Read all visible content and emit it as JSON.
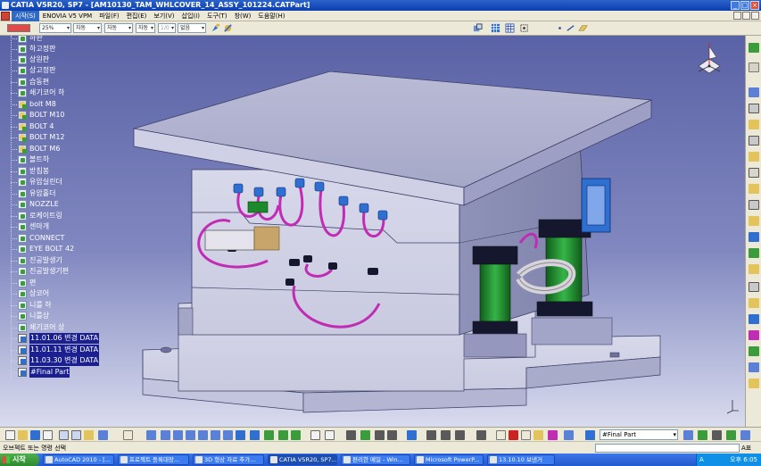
{
  "window": {
    "title": "CATIA V5R20, SP7 - [AM10130_TAM_WHLCOVER_14_ASSY_101224.CATPart]",
    "buttons": [
      "_",
      "□",
      "×"
    ]
  },
  "menubar": {
    "items": [
      "시작(S)",
      "ENOVIA V5 VPM",
      "파일(F)",
      "편집(E)",
      "보기(V)",
      "삽입(I)",
      "도구(T)",
      "창(W)",
      "도움말(H)"
    ]
  },
  "graphic_properties": {
    "transparency": "25%",
    "line_weight": "자동",
    "line_type": "자동",
    "point_symbol": "자동",
    "layer_value": "1/0",
    "layer": "없음",
    "fill_color": "#e24a4a"
  },
  "tree": {
    "items": [
      {
        "label": "하판",
        "icon": "part-icon"
      },
      {
        "label": "하고정판",
        "icon": "part-icon"
      },
      {
        "label": "상원판",
        "icon": "part-icon"
      },
      {
        "label": "상고정판",
        "icon": "part-icon"
      },
      {
        "label": "습동편",
        "icon": "part-icon"
      },
      {
        "label": "쇄기코어 하",
        "icon": "part-icon"
      },
      {
        "label": "bolt M8",
        "icon": "body-icon"
      },
      {
        "label": "BOLT M10",
        "icon": "body-icon"
      },
      {
        "label": "BOLT 4",
        "icon": "body-icon"
      },
      {
        "label": "BOLT M12",
        "icon": "body-icon"
      },
      {
        "label": "BOLT M6",
        "icon": "body-icon"
      },
      {
        "label": "볼트하",
        "icon": "part-icon"
      },
      {
        "label": "받침봉",
        "icon": "part-icon"
      },
      {
        "label": "유압실린더",
        "icon": "part-icon"
      },
      {
        "label": "유압홀더",
        "icon": "part-icon"
      },
      {
        "label": "NOZZLE",
        "icon": "part-icon"
      },
      {
        "label": "로케이트링",
        "icon": "part-icon"
      },
      {
        "label": "센마개",
        "icon": "part-icon"
      },
      {
        "label": "CONNECT",
        "icon": "part-icon"
      },
      {
        "label": "EYE BOLT 42",
        "icon": "part-icon"
      },
      {
        "label": "진공발생기",
        "icon": "part-icon"
      },
      {
        "label": "진공발생기편",
        "icon": "part-icon"
      },
      {
        "label": "편",
        "icon": "part-icon"
      },
      {
        "label": "상코어",
        "icon": "part-icon"
      },
      {
        "label": "니를 하",
        "icon": "part-icon"
      },
      {
        "label": "니를상",
        "icon": "part-icon"
      },
      {
        "label": "쇄기코어 상",
        "icon": "part-icon"
      },
      {
        "label": "11.01.06 변경 DATA",
        "icon": "set-icon",
        "selected": true
      },
      {
        "label": "11.01.11 변경 DATA",
        "icon": "set-icon",
        "selected": true
      },
      {
        "label": "11.03.30 변경 DATA",
        "icon": "set-icon",
        "selected": true
      },
      {
        "label": "#Final Part",
        "icon": "set-icon",
        "selected": true
      }
    ]
  },
  "bottom_toolbar": {
    "current_body": "#Final Part"
  },
  "statusbar": {
    "message": "오브젝트 또는 명령 선택",
    "command_label": "",
    "key_info": "A표"
  },
  "taskbar": {
    "start_label": "시작",
    "tasks": [
      {
        "label": "AutoCAD 2010 - [...",
        "active": false
      },
      {
        "label": "프로젝트 등록대장...",
        "active": false
      },
      {
        "label": "3D 형상 자료 추가...",
        "active": false
      },
      {
        "label": "CATIA V5R20, SP7...",
        "active": true
      },
      {
        "label": "편리한 메일 - Win...",
        "active": false
      },
      {
        "label": "Microsoft PowerP...",
        "active": false
      },
      {
        "label": "13.10.10 보낸거",
        "active": false
      }
    ],
    "clock": "오후 6:05",
    "ime": "A"
  },
  "colors": {
    "viewport_top": "#5a62a6",
    "viewport_bottom": "#d9dbee",
    "part_fill": "#c7c8e0",
    "hose_color": "#c22bb3",
    "fitting_color": "#2e6fd1",
    "cylinder_green": "#1c8a2a"
  }
}
